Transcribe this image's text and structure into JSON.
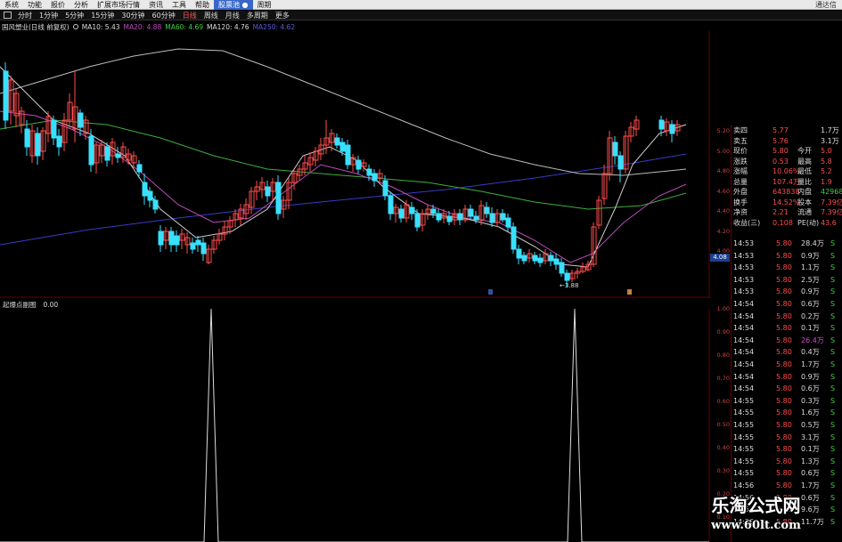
{
  "menubar": {
    "items": [
      "系统",
      "功能",
      "报价",
      "分析",
      "扩展市场行情",
      "资讯",
      "工具",
      "帮助",
      "股票池 ●",
      "周期"
    ],
    "active_index": 8,
    "right": "通达信"
  },
  "periodbar": {
    "items": [
      "分时",
      "1分钟",
      "5分钟",
      "15分钟",
      "30分钟",
      "60分钟",
      "日线",
      "周线",
      "月线",
      "多周期",
      "更多"
    ],
    "active_index": 6
  },
  "legend": {
    "name": "国风塑业(日线 前复权)",
    "items": [
      {
        "label": "MA10: 5.43",
        "color": "#dddddd"
      },
      {
        "label": "MA20: 4.88",
        "color": "#c04ac0"
      },
      {
        "label": "MA60: 4.69",
        "color": "#3fcf3f"
      },
      {
        "label": "MA120: 4.76",
        "color": "#dddddd"
      },
      {
        "label": "MA250: 4.62",
        "color": "#5a5ad8"
      }
    ]
  },
  "price_axis": {
    "labels": [
      "5.20",
      "5.00",
      "4.80",
      "4.60",
      "4.40",
      "4.20",
      "4.00"
    ],
    "current_tag": "4.08"
  },
  "indicator_axis": {
    "labels": [
      "1.00",
      "0.90",
      "0.80",
      "0.70",
      "0.60",
      "0.50",
      "0.40",
      "0.30",
      "0.20",
      "0.10"
    ]
  },
  "chart_annotations": {
    "low_label": "3.88",
    "low_arrow": "←3.88"
  },
  "indicator": {
    "name": "起爆点副图",
    "value": "0.00"
  },
  "quote": [
    {
      "k": "卖四",
      "v": "5.77",
      "v2": "1.7万"
    },
    {
      "k": "卖五",
      "v": "5.76",
      "v2": "3.1万"
    },
    {
      "k": "现价",
      "v": "5.80",
      "k2": "今开",
      "v3": "5.0"
    },
    {
      "k": "涨跌",
      "v": "0.53",
      "k2": "最高",
      "v3": "5.8"
    },
    {
      "k": "涨幅",
      "v": "10.06%",
      "k2": "最低",
      "v3": "5.2"
    },
    {
      "k": "总量",
      "v": "107.4万",
      "k2": "量比",
      "v3": "1.9"
    },
    {
      "k": "外盘",
      "v": "643838",
      "k2": "内盘",
      "v3": "42968"
    },
    {
      "k": "换手",
      "v": "14.52%",
      "k2": "股本",
      "v3": "7.39亿"
    },
    {
      "k": "净资",
      "v": "2.21",
      "k2": "流通",
      "v3": "7.39亿"
    },
    {
      "k": "收益(三)",
      "v": "0.108",
      "k2": "PE(动)",
      "v3": "43.6"
    }
  ],
  "ticks": [
    {
      "t": "14:53",
      "p": "5.80",
      "v": "28.4万",
      "s": "S"
    },
    {
      "t": "14:53",
      "p": "5.80",
      "v": "0.9万",
      "s": "S"
    },
    {
      "t": "14:53",
      "p": "5.80",
      "v": "1.1万",
      "s": "S"
    },
    {
      "t": "14:53",
      "p": "5.80",
      "v": "2.5万",
      "s": "S"
    },
    {
      "t": "14:53",
      "p": "5.80",
      "v": "0.9万",
      "s": "S"
    },
    {
      "t": "14:54",
      "p": "5.80",
      "v": "0.6万",
      "s": "S"
    },
    {
      "t": "14:54",
      "p": "5.80",
      "v": "0.2万",
      "s": "S"
    },
    {
      "t": "14:54",
      "p": "5.80",
      "v": "0.1万",
      "s": "S"
    },
    {
      "t": "14:54",
      "p": "5.80",
      "v": "26.4万",
      "s": "S"
    },
    {
      "t": "14:54",
      "p": "5.80",
      "v": "0.4万",
      "s": "S"
    },
    {
      "t": "14:54",
      "p": "5.80",
      "v": "1.7万",
      "s": "S"
    },
    {
      "t": "14:54",
      "p": "5.80",
      "v": "0.9万",
      "s": "S"
    },
    {
      "t": "14:54",
      "p": "5.80",
      "v": "0.6万",
      "s": "S"
    },
    {
      "t": "14:55",
      "p": "5.80",
      "v": "0.3万",
      "s": "S"
    },
    {
      "t": "14:55",
      "p": "5.80",
      "v": "1.6万",
      "s": "S"
    },
    {
      "t": "14:55",
      "p": "5.80",
      "v": "0.5万",
      "s": "S"
    },
    {
      "t": "14:55",
      "p": "5.80",
      "v": "3.1万",
      "s": "S"
    },
    {
      "t": "14:55",
      "p": "5.80",
      "v": "0.1万",
      "s": "S"
    },
    {
      "t": "14:55",
      "p": "5.80",
      "v": "1.3万",
      "s": "S"
    },
    {
      "t": "14:55",
      "p": "5.80",
      "v": "0.6万",
      "s": "S"
    },
    {
      "t": "14:56",
      "p": "5.80",
      "v": "1.7万",
      "s": "S"
    },
    {
      "t": "14:56",
      "p": "5.80",
      "v": "0.6万",
      "s": "S"
    },
    {
      "t": "14:56",
      "p": "5.80",
      "v": "9.6万",
      "s": "S"
    },
    {
      "t": "14:56",
      "p": "5.80",
      "v": "11.7万",
      "s": "S"
    }
  ],
  "watermark": {
    "line1": "乐淘公式网",
    "line2": "www.60lt.com"
  },
  "colors": {
    "up": "#ff4d4d",
    "down": "#38e0ff",
    "axis_red": "#cc4444"
  }
}
